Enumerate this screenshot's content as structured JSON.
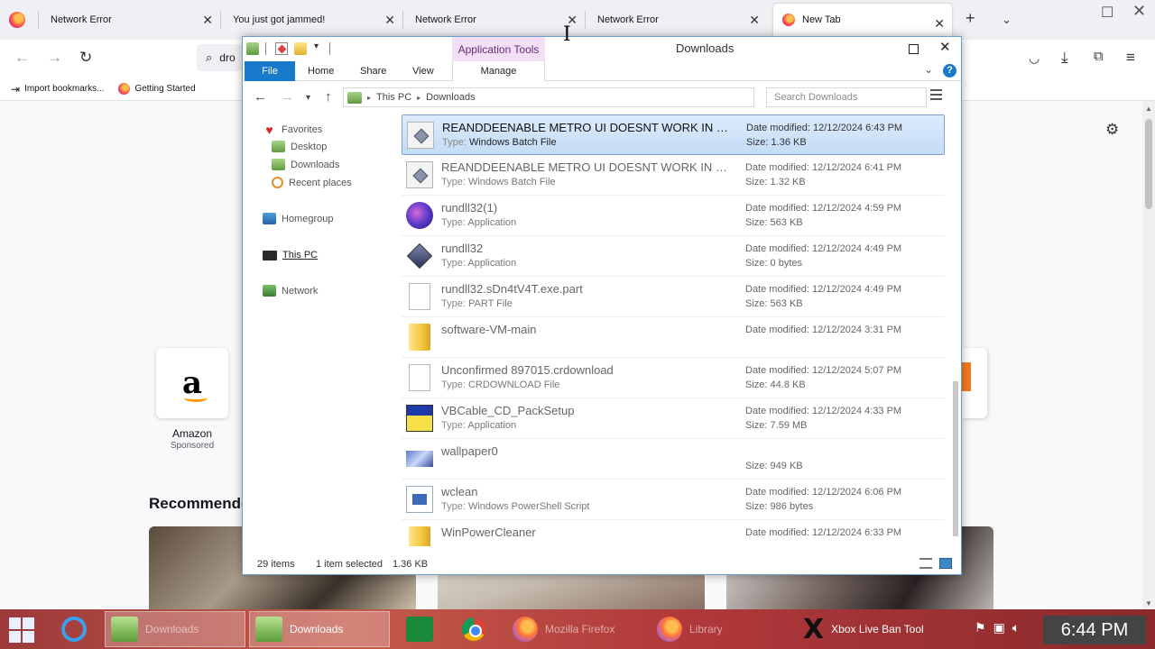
{
  "browser": {
    "tabs": [
      {
        "label": "Network Error"
      },
      {
        "label": "You just got jammed!"
      },
      {
        "label": "Network Error"
      },
      {
        "label": "Network Error"
      },
      {
        "label": "New Tab"
      }
    ],
    "url_text": "dro",
    "bookmarks": [
      {
        "label": "Import bookmarks..."
      },
      {
        "label": "Getting Started"
      }
    ],
    "shortcut_tile": {
      "label": "Amazon",
      "sublabel": "Sponsored"
    },
    "recommended_heading": "Recommende"
  },
  "explorer": {
    "title": "Downloads",
    "context_tab": "Application Tools",
    "ribbon_tabs": {
      "file": "File",
      "home": "Home",
      "share": "Share",
      "view": "View",
      "manage": "Manage"
    },
    "breadcrumb": {
      "root": "This PC",
      "current": "Downloads"
    },
    "search_placeholder": "Search Downloads",
    "nav": {
      "favorites": "Favorites",
      "desktop": "Desktop",
      "downloads": "Downloads",
      "recent": "Recent places",
      "homegroup": "Homegroup",
      "this_pc": "This PC",
      "network": "Network"
    },
    "files": [
      {
        "name": "REANDDEENABLE METRO UI DOESNT WORK IN WIN...",
        "type": "Windows Batch File",
        "date": "12/12/2024 6:43 PM",
        "size": "1.36 KB",
        "icon": "batch-icon"
      },
      {
        "name": "REANDDEENABLE METRO UI DOESNT WORK IN WIN...",
        "type": "Windows Batch File",
        "date": "12/12/2024 6:41 PM",
        "size": "1.32 KB",
        "icon": "batch-icon"
      },
      {
        "name": "rundll32(1)",
        "type": "Application",
        "date": "12/12/2024 4:59 PM",
        "size": "563 KB",
        "icon": "app-globe-icon"
      },
      {
        "name": "rundll32",
        "type": "Application",
        "date": "12/12/2024 4:49 PM",
        "size": "0 bytes",
        "icon": "app-diamond-icon"
      },
      {
        "name": "rundll32.sDn4tV4T.exe.part",
        "type": "PART File",
        "date": "12/12/2024 4:49 PM",
        "size": "563 KB",
        "icon": "blank-file-icon"
      },
      {
        "name": "software-VM-main",
        "type": "",
        "date": "12/12/2024 3:31 PM",
        "size": "",
        "icon": "folder-icon"
      },
      {
        "name": "Unconfirmed 897015.crdownload",
        "type": "CRDOWNLOAD File",
        "date": "12/12/2024 5:07 PM",
        "size": "44.8 KB",
        "icon": "blank-file-icon"
      },
      {
        "name": "VBCable_CD_PackSetup",
        "type": "Application",
        "date": "12/12/2024 4:33 PM",
        "size": "7.59 MB",
        "icon": "vbcable-icon"
      },
      {
        "name": "wallpaper0",
        "type": "",
        "date": "",
        "size": "949 KB",
        "icon": "image-icon"
      },
      {
        "name": "wclean",
        "type": "Windows PowerShell Script",
        "date": "12/12/2024 6:06 PM",
        "size": "986 bytes",
        "icon": "powershell-icon"
      },
      {
        "name": "WinPowerCleaner",
        "type": "",
        "date": "12/12/2024 6:33 PM",
        "size": "",
        "icon": "folder-icon"
      }
    ],
    "labels": {
      "type_prefix": "Type:",
      "date_prefix": "Date modified:",
      "size_prefix": "Size:"
    },
    "status": {
      "count": "29 items",
      "selected": "1 item selected",
      "selected_size": "1.36 KB"
    }
  },
  "taskbar": {
    "items": [
      {
        "label": "Downloads"
      },
      {
        "label": "Downloads"
      },
      {
        "label": "Mozilla Firefox"
      },
      {
        "label": "Library"
      },
      {
        "label": "Xbox Live Ban Tool"
      }
    ],
    "clock": "6:44 PM"
  }
}
